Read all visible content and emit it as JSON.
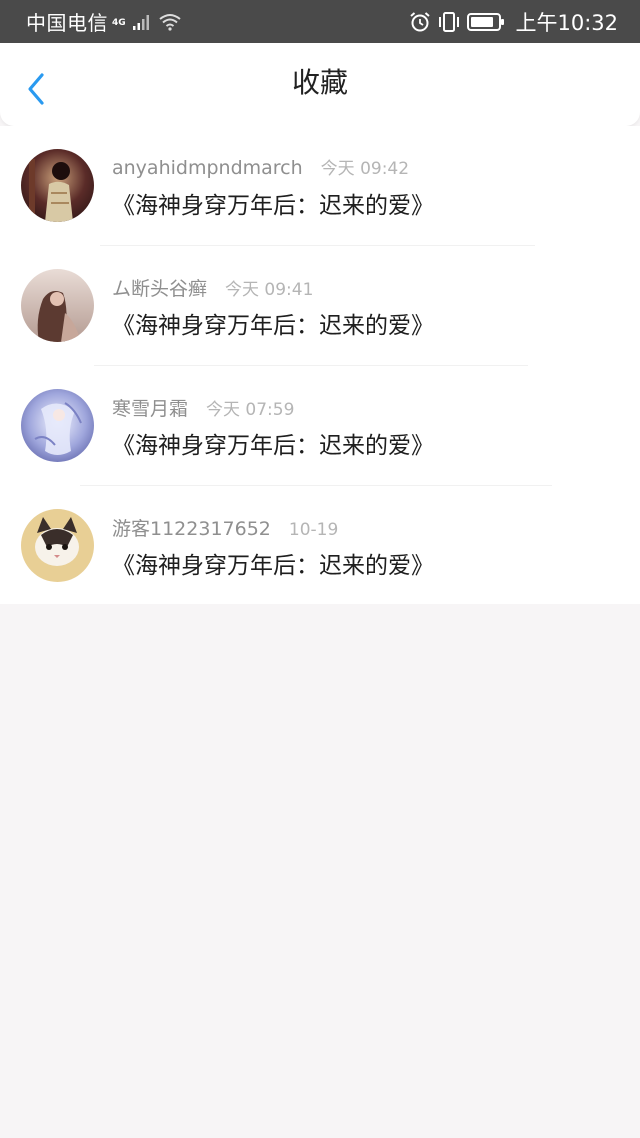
{
  "status_bar": {
    "carrier": "中国电信",
    "network": "4G",
    "time": "上午10:32"
  },
  "header": {
    "title": "收藏"
  },
  "items": [
    {
      "username": "anyahidmpndmarch",
      "time": "今天 09:42",
      "book": "《海神身穿万年后：迟来的爱》"
    },
    {
      "username": "ム断头谷癣",
      "time": "今天 09:41",
      "book": "《海神身穿万年后：迟来的爱》"
    },
    {
      "username": "寒雪月霜",
      "time": "今天 07:59",
      "book": "《海神身穿万年后：迟来的爱》"
    },
    {
      "username": "游客1122317652",
      "time": "10-19",
      "book": "《海神身穿万年后：迟来的爱》"
    }
  ],
  "colors": {
    "accent": "#2a9af0",
    "status_bar": "#4a4a4a",
    "background": "#f7f5f6"
  }
}
